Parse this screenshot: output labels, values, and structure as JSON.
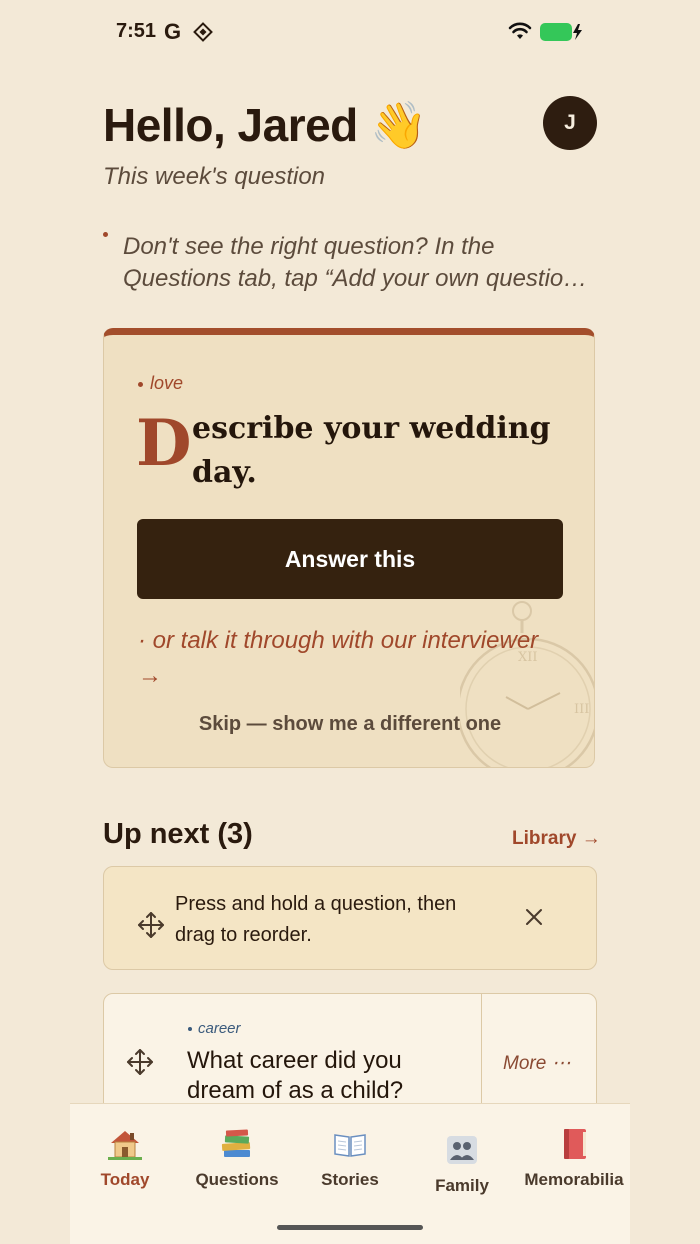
{
  "status_bar": {
    "time": "7:51",
    "google_glyph": "G",
    "icons": [
      "google-icon",
      "diamond-icon",
      "wifi-icon",
      "battery-charging-icon"
    ],
    "battery_color": "#34C759"
  },
  "header": {
    "greeting": "Hello, Jared 👋",
    "avatar_initial": "J",
    "subtitle": "This week's question"
  },
  "tip": {
    "line1": "Don't see the right question? In the",
    "line2": "Questions tab, tap “Add your own questio…"
  },
  "question_card": {
    "tag": "love",
    "drop_cap": "D",
    "title_rest": "escribe your wedding day.",
    "answer_label": "Answer this",
    "interviewer_link": "· or talk it through with our interviewer →",
    "skip_label": "Skip — show me a different one",
    "accent_color": "#A34E2B"
  },
  "up_next": {
    "title": "Up next (3)",
    "library_link": "Library →",
    "hint_text": "Press and hold a question, then drag to reorder.",
    "items": [
      {
        "tag": "career",
        "question": "What career did you dream of as a child?",
        "more_label": "More ⋯"
      }
    ]
  },
  "tab_bar": {
    "tabs": [
      {
        "label": "Today",
        "icon": "house-icon",
        "active": true
      },
      {
        "label": "Questions",
        "icon": "books-icon",
        "active": false
      },
      {
        "label": "Stories",
        "icon": "open-book-icon",
        "active": false
      },
      {
        "label": "Family",
        "icon": "family-icon",
        "active": false
      },
      {
        "label": "Memorabilia",
        "icon": "red-book-icon",
        "active": false
      }
    ]
  }
}
